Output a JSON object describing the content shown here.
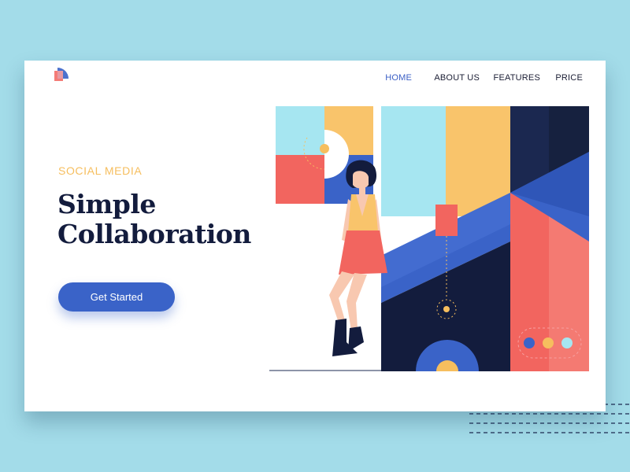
{
  "colors": {
    "background": "#a3dce9",
    "card": "#ffffff",
    "accent_blue": "#3a63c8",
    "navy": "#131c3d",
    "yellow": "#f6be5e",
    "coral": "#f2655f",
    "light_blue": "#a6e6f1"
  },
  "logo": {
    "icon": "quarter-circle-logo-icon"
  },
  "nav": {
    "items": [
      {
        "label": "HOME",
        "active": true
      },
      {
        "label": "ABOUT US",
        "active": false
      },
      {
        "label": "FEATURES",
        "active": false
      },
      {
        "label": "PRICE",
        "active": false
      }
    ]
  },
  "hero": {
    "eyebrow": "SOCIAL MEDIA",
    "title_line1": "Simple",
    "title_line2": "Collaboration",
    "cta_label": "Get Started"
  },
  "illustration": {
    "description_icon": "woman-sitting-geometric-illustration",
    "carousel_dots": [
      "#3a63c8",
      "#f6be5e",
      "#a6e6f1"
    ]
  }
}
